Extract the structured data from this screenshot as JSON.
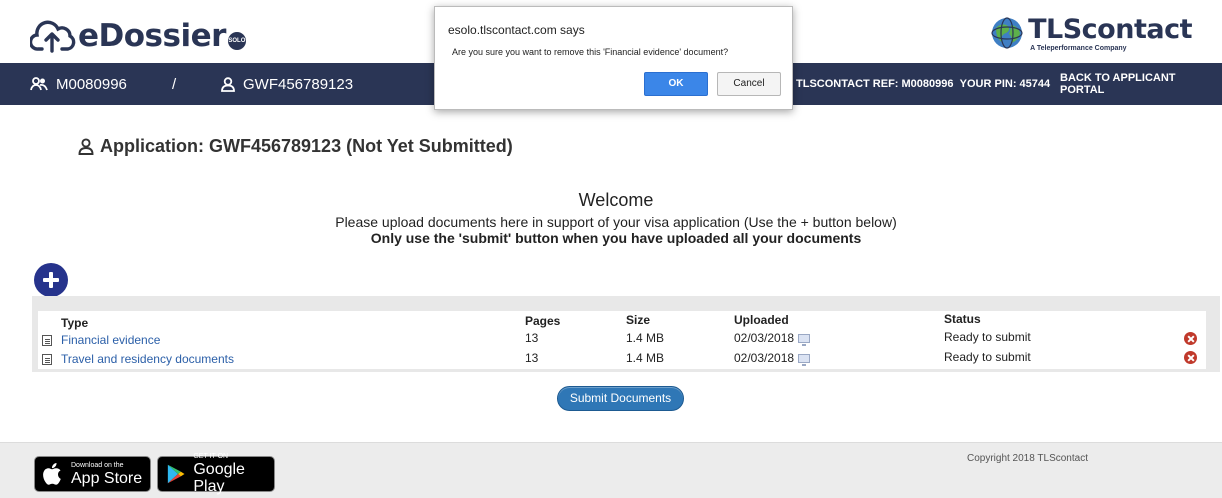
{
  "header": {
    "brand": "eDossier",
    "brand_badge": "SOLO",
    "partner_name": "TLScontact",
    "partner_tagline": "A Teleperformance Company"
  },
  "navbar": {
    "group_id": "M0080996",
    "separator": "/",
    "applicant_id": "GWF456789123",
    "ref_label": "TLSCONTACT REF:",
    "ref_value": "M0080996",
    "pin_label": "YOUR PIN:",
    "pin_value": "45744",
    "back_link": "BACK TO APPLICANT PORTAL"
  },
  "application": {
    "title": "Application: GWF456789123 (Not Yet Submitted)"
  },
  "welcome": {
    "heading": "Welcome",
    "line1": "Please upload documents here in support of your visa application (Use the + button below)",
    "line2": "Only use the 'submit' button when you have uploaded all your documents"
  },
  "table": {
    "headers": {
      "type": "Type",
      "pages": "Pages",
      "size": "Size",
      "uploaded": "Uploaded",
      "status": "Status"
    },
    "rows": [
      {
        "type": "Financial evidence",
        "pages": "13",
        "size": "1.4 MB",
        "uploaded": "02/03/2018",
        "status": "Ready to submit"
      },
      {
        "type": "Travel and residency documents",
        "pages": "13",
        "size": "1.4 MB",
        "uploaded": "02/03/2018",
        "status": "Ready to submit"
      }
    ]
  },
  "submit_label": "Submit Documents",
  "footer": {
    "appstore_small": "Download on the",
    "appstore_big": "App Store",
    "googleplay_small": "GET IT ON",
    "googleplay_big": "Google Play",
    "copyright": "Copyright 2018 TLScontact"
  },
  "dialog": {
    "title": "esolo.tlscontact.com says",
    "message": "Are you sure you want to remove this 'Financial evidence' document?",
    "ok_label": "OK",
    "cancel_label": "Cancel"
  },
  "colors": {
    "navbar": "#2a3555",
    "add_button": "#26338c",
    "link": "#2b5fa8",
    "delete": "#c0392b",
    "submit": "#2f77b6",
    "dialog_ok": "#3b86e8"
  },
  "icons": {
    "brand": "cloud-upload-icon",
    "partner": "globe-icon",
    "group": "users-icon",
    "applicant": "user-icon",
    "add": "plus-circle-icon",
    "document": "document-icon",
    "uploaded": "monitor-icon",
    "delete": "remove-circle-icon"
  }
}
